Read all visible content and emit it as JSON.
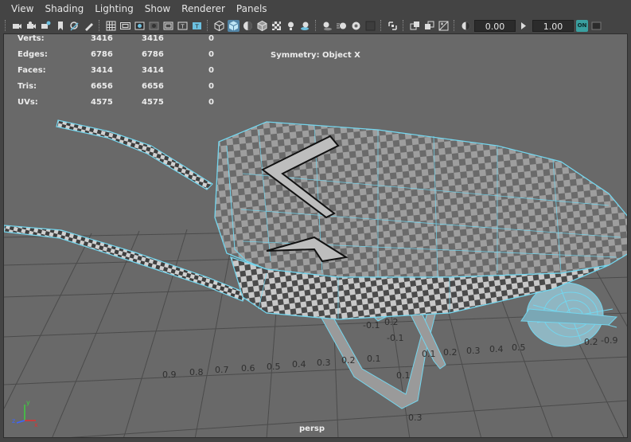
{
  "menubar": {
    "items": [
      "View",
      "Shading",
      "Lighting",
      "Show",
      "Renderer",
      "Panels"
    ]
  },
  "toolbar": {
    "field1_value": "0.00",
    "field2_value": "1.00",
    "on_badge": "ON",
    "icons": [
      "select-camera-icon",
      "camera-attributes-icon",
      "bookmark-icon",
      "image-plane-icon",
      "2d-pan-zoom-icon",
      "grease-pencil-icon",
      "grid-icon",
      "film-gate-icon",
      "resolution-gate-icon",
      "gate-mask-icon",
      "field-chart-icon",
      "safe-action-icon",
      "safe-title-icon",
      "wireframe-icon",
      "smooth-shade-all-icon",
      "default-material-icon",
      "wireframe-on-shaded-icon",
      "xray-icon",
      "use-all-lights-icon",
      "shadows-icon",
      "screen-space-ambient-occlusion-icon",
      "motion-blur-icon",
      "multisample-antialiasing-icon",
      "depth-of-field-icon",
      "isolate-select-icon",
      "xray-joints-icon",
      "xray-active-components-icon",
      "exposure-icon",
      "gamma-icon",
      "color-management-icon"
    ]
  },
  "hud": {
    "rows": [
      {
        "label": "Verts:",
        "c1": "3416",
        "c2": "3416",
        "c3": "0"
      },
      {
        "label": "Edges:",
        "c1": "6786",
        "c2": "6786",
        "c3": "0"
      },
      {
        "label": "Faces:",
        "c1": "3414",
        "c2": "3414",
        "c3": "0"
      },
      {
        "label": "Tris:",
        "c1": "6656",
        "c2": "6656",
        "c3": "0"
      },
      {
        "label": "UVs:",
        "c1": "4575",
        "c2": "4575",
        "c3": "0"
      }
    ],
    "symmetry": "Symmetry: Object X",
    "camera": "persp"
  },
  "grid_labels": [
    "0.9",
    "0.8",
    "0.7",
    "0.6",
    "0.5",
    "0.4",
    "0.3",
    "0.2",
    "0.1",
    "-0.1",
    "0.1",
    "0.2",
    "0.3",
    "0.4",
    "0.5",
    "-0.9",
    "-0.1",
    "0.1",
    "0.2",
    "0.3",
    "0.2"
  ],
  "axis_gizmo": {
    "x": "x",
    "y": "y",
    "z": "z"
  },
  "colors": {
    "menubar_bg": "#444444",
    "viewport_bg": "#696969",
    "grid_line": "#4a4a4a",
    "wire_selected": "#74d6ee",
    "accent": "#5285a6"
  }
}
